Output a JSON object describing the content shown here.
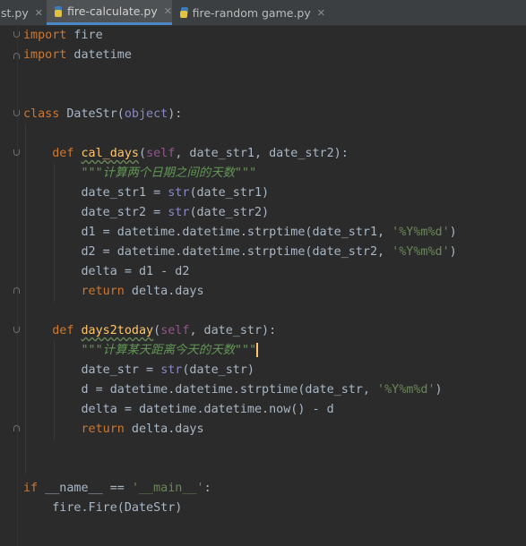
{
  "tabs": [
    {
      "label": "st.py",
      "close": "✕",
      "active": false
    },
    {
      "label": "fire-calculate.py",
      "close": "✕",
      "active": true
    },
    {
      "label": "fire-random game.py",
      "close": "✕",
      "active": false
    }
  ],
  "code": {
    "l1": {
      "kw": "import",
      "rest": " fire"
    },
    "l2": {
      "kw": "import",
      "rest": " datetime"
    },
    "l5": {
      "kw": "class",
      "name": " DateStr(",
      "base": "object",
      "end": "):"
    },
    "l7": {
      "kw": "def",
      "fn": "cal_days",
      "open": "(",
      "self": "self",
      "rest": ", date_str1, date_str2):"
    },
    "l8": {
      "doc": "\"\"\"计算两个日期之间的天数\"\"\""
    },
    "l9": {
      "a": "date_str1 = ",
      "bi": "str",
      "b": "(date_str1)"
    },
    "l10": {
      "a": "date_str2 = ",
      "bi": "str",
      "b": "(date_str2)"
    },
    "l11": {
      "a": "d1 = datetime.datetime.strptime(date_str1, ",
      "str": "'%Y%m%d'",
      "b": ")"
    },
    "l12": {
      "a": "d2 = datetime.datetime.strptime(date_str2, ",
      "str": "'%Y%m%d'",
      "b": ")"
    },
    "l13": {
      "a": "delta = d1 - d2"
    },
    "l14": {
      "kw": "return",
      "rest": " delta.days"
    },
    "l16": {
      "kw": "def",
      "fn": "days2today",
      "open": "(",
      "self": "self",
      "rest": ", date_str):"
    },
    "l17": {
      "doc": "\"\"\"计算某天距离今天的天数\"\"\""
    },
    "l18": {
      "a": "date_str = ",
      "bi": "str",
      "b": "(date_str)"
    },
    "l19": {
      "a": "d = datetime.datetime.strptime(date_str, ",
      "str": "'%Y%m%d'",
      "b": ")"
    },
    "l20": {
      "a": "delta = datetime.datetime.now() - d"
    },
    "l21": {
      "kw": "return",
      "rest": " delta.days"
    },
    "l24": {
      "kw": "if",
      "a": " __name__ == ",
      "str": "'__main__'",
      "b": ":"
    },
    "l25": {
      "a": "fire.Fire(DateStr)"
    }
  }
}
